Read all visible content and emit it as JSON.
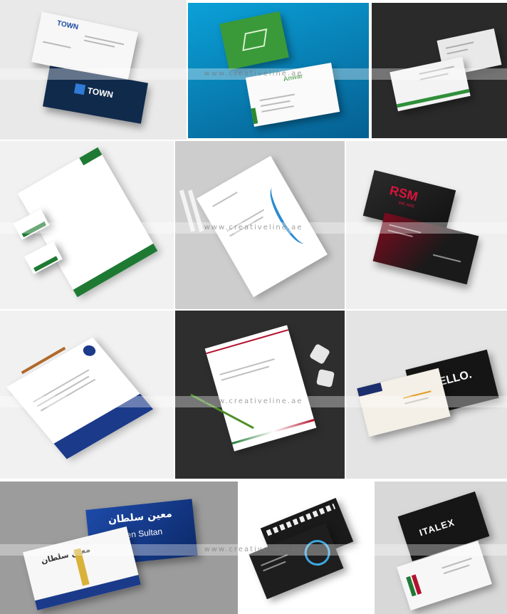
{
  "gallery": {
    "items": [
      {
        "brand": "TOWN"
      },
      {
        "brand": "Anwar"
      },
      {
        "brand": ""
      },
      {
        "brand": ""
      },
      {
        "brand": ""
      },
      {
        "brand": "RSM",
        "sub": "WE ARE"
      },
      {
        "brand": ""
      },
      {
        "brand": ""
      },
      {
        "brand": "HELLO."
      },
      {
        "brand_ar": "معين سلطان",
        "brand": "Maeen Sultan"
      },
      {
        "brand": ""
      },
      {
        "brand": "ITALEX"
      }
    ]
  },
  "watermark": "www.creativeline.ae",
  "colors": {
    "teal": "#0e8cc0",
    "green": "#1e7a33",
    "crimson": "#b3122e",
    "navy": "#1b3a8a",
    "charcoal": "#1c1c1c"
  }
}
